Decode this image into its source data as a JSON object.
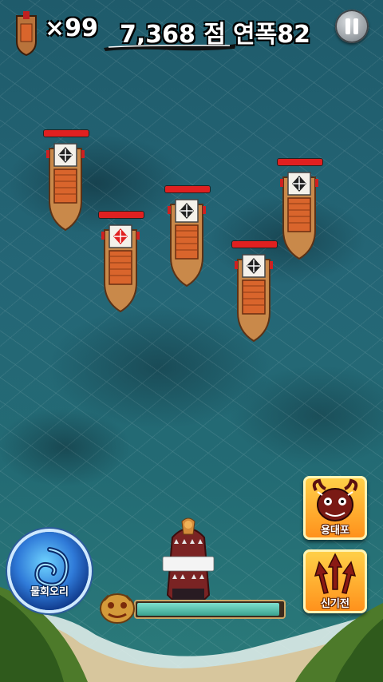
{
  "hud": {
    "lives_text": "×99",
    "score_text": "7,368 점",
    "combo_text": "연폭82",
    "pause_icon": "pause-icon"
  },
  "enemies": [
    {
      "flag": "diamond-cross",
      "flag_color": "#222222",
      "hp": 1.0
    },
    {
      "flag": "diamond-cross",
      "flag_color": "#e02020",
      "hp": 1.0
    },
    {
      "flag": "diamond-cross",
      "flag_color": "#222222",
      "hp": 1.0
    },
    {
      "flag": "diamond-cross",
      "flag_color": "#222222",
      "hp": 1.0
    },
    {
      "flag": "diamond-cross",
      "flag_color": "#222222",
      "hp": 1.0
    }
  ],
  "skills": {
    "whirlpool_label": "물회오리",
    "dragon_label": "용대포",
    "arrow_label": "신기전"
  },
  "power": {
    "fill": 0.98
  },
  "colors": {
    "hp": "#e02020",
    "power": "#3aa38f",
    "skill": "#ff8f1a"
  }
}
